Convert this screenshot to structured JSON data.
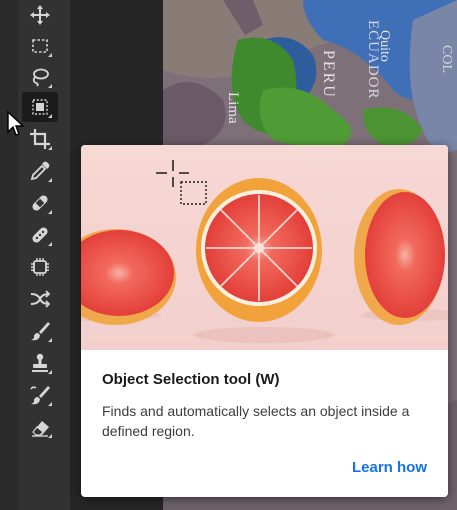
{
  "toolbar": {
    "tools": [
      {
        "name": "move-tool",
        "icon": "move-icon"
      },
      {
        "name": "marquee-tool",
        "icon": "marquee-icon"
      },
      {
        "name": "lasso-tool",
        "icon": "lasso-icon"
      },
      {
        "name": "object-selection-tool",
        "icon": "object-selection-icon",
        "active": true
      },
      {
        "name": "crop-tool",
        "icon": "crop-icon"
      },
      {
        "name": "eyedropper-tool",
        "icon": "eyedropper-icon"
      },
      {
        "name": "healing-brush-tool",
        "icon": "bandage-icon"
      },
      {
        "name": "patch-tool",
        "icon": "patch-icon"
      },
      {
        "name": "content-aware-tool",
        "icon": "content-aware-icon"
      },
      {
        "name": "red-eye-tool",
        "icon": "swap-icon"
      },
      {
        "name": "brush-tool",
        "icon": "brush-icon"
      },
      {
        "name": "stamp-tool",
        "icon": "stamp-icon"
      },
      {
        "name": "history-brush-tool",
        "icon": "history-brush-icon"
      },
      {
        "name": "eraser-tool",
        "icon": "eraser-icon"
      }
    ]
  },
  "canvas": {
    "map_labels": [
      "Quito",
      "ECUADOR",
      "PERU",
      "Lima",
      "COL"
    ]
  },
  "tooltip": {
    "title": "Object Selection tool (W)",
    "description": "Finds and automatically selects an object inside a defined region.",
    "link": "Learn how"
  },
  "colors": {
    "toolbar_bg": "#323232",
    "tooltip_bg": "#ffffff",
    "link": "#1473e6",
    "image_bg": "#f4d4d1",
    "grapefruit_flesh": "#e8463f",
    "grapefruit_peel": "#f2a23a"
  }
}
